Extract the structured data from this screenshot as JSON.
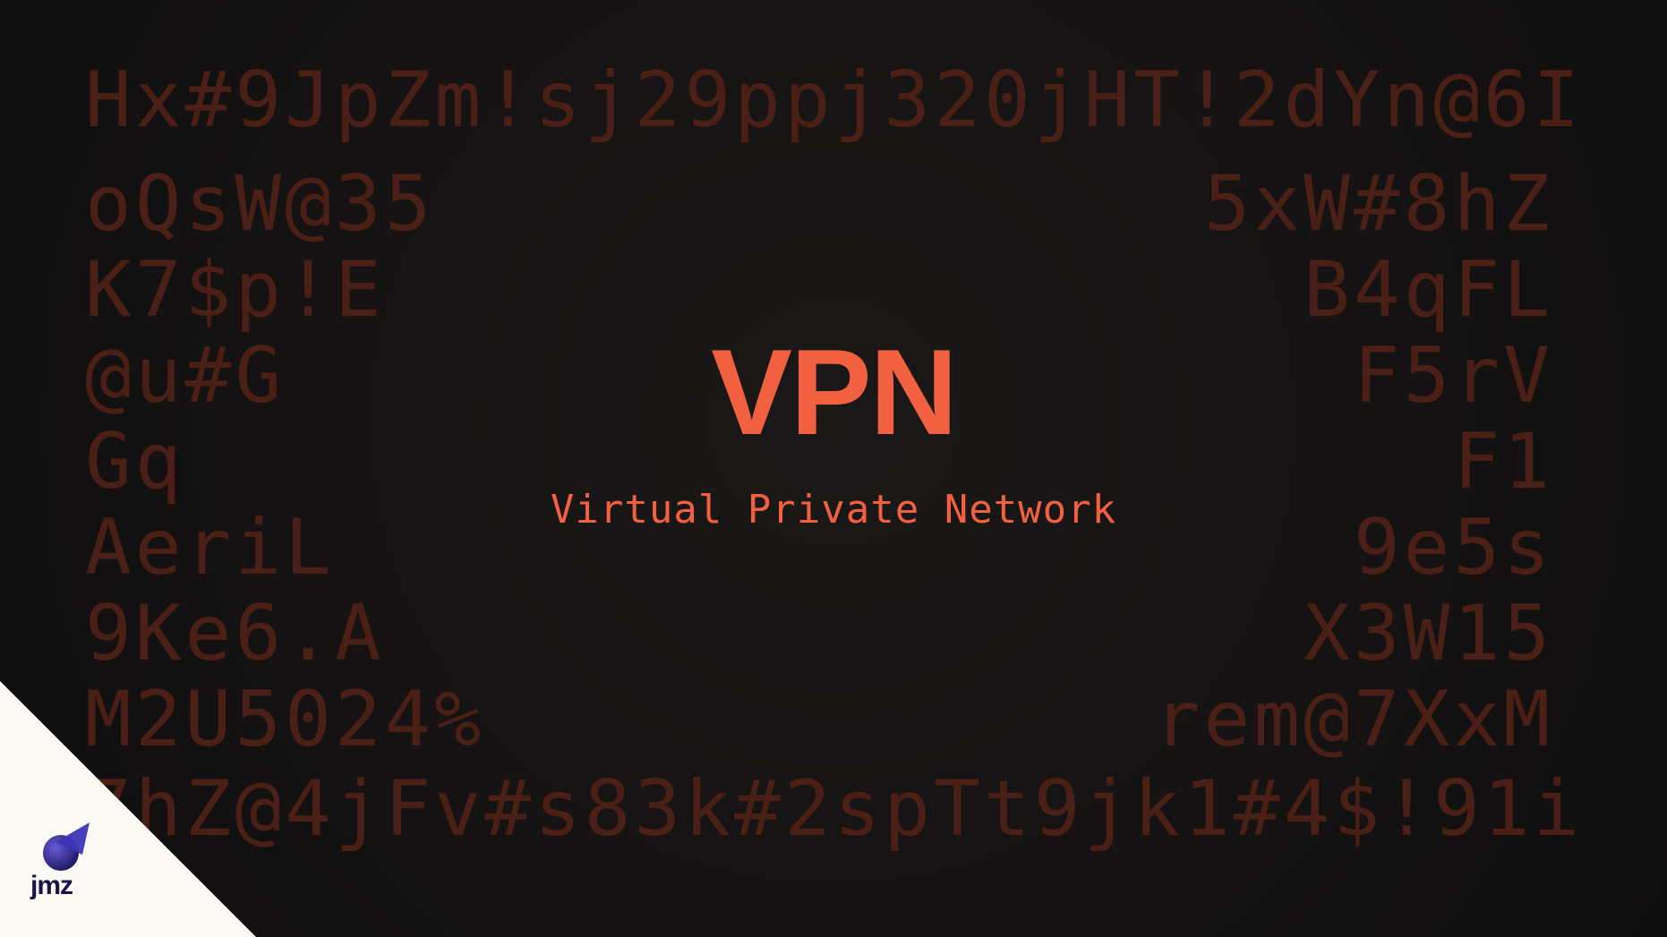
{
  "background_rows": {
    "top": "Hx#9JpZm!sj29ppj320jHT!2dYn@6I",
    "left": [
      "oQsW@35",
      "K7$p!E",
      "@u#G",
      "Gq",
      "AeriL",
      "9Ke6.A",
      "M2U5024%"
    ],
    "right": [
      "5xW#8hZ",
      "B4qFL",
      "F5rV",
      "F1",
      "9e5s",
      "X3W15",
      "rem@7XxM"
    ],
    "bottom": "7hZ@4jFv#s83k#2spTt9jk1#4$!91i"
  },
  "hero": {
    "title": "VPN",
    "subtitle": "Virtual Private Network"
  },
  "brand": {
    "logo_text": "jmz",
    "accent": "#f2613f",
    "logo_color": "#1a1446"
  }
}
